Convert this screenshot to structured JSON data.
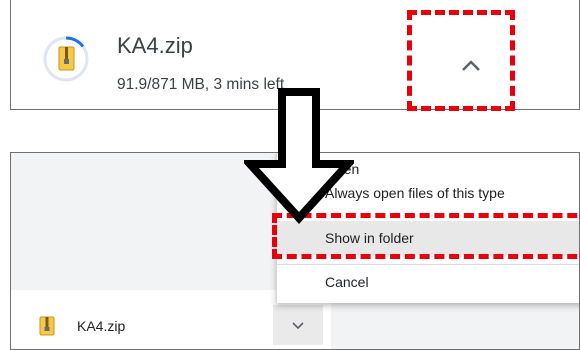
{
  "download": {
    "file_name": "KA4.zip",
    "progress_text": "91.9/871 MB, 3 mins left"
  },
  "menu": {
    "items": [
      {
        "label": "Open"
      },
      {
        "label": "Always open files of this type"
      },
      {
        "label": "Show in folder"
      },
      {
        "label": "Cancel"
      }
    ]
  },
  "bottom_bar": {
    "file_name": "KA4.zip"
  },
  "icons": {
    "file_type": "zip-file-icon",
    "expand": "chevron-up-icon",
    "dropdown": "chevron-down-icon",
    "pointer": "down-arrow-icon"
  },
  "colors": {
    "highlight_dashes": "#e8000b",
    "progress_ring": "#1a73e8",
    "zipper": "#e8a800"
  }
}
